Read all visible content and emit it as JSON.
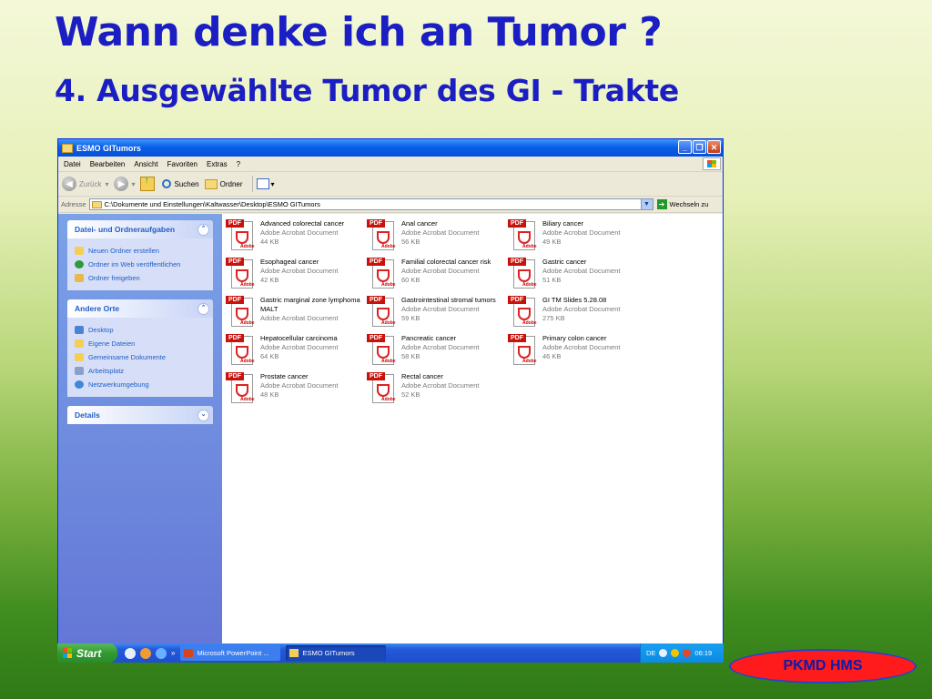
{
  "slide": {
    "title": "Wann denke ich an Tumor ?",
    "subtitle": "4. Ausgewählte Tumor des GI - Trakte",
    "badge": "PKMD HMS"
  },
  "window": {
    "title": "ESMO GITumors",
    "menu": [
      "Datei",
      "Bearbeiten",
      "Ansicht",
      "Favoriten",
      "Extras",
      "?"
    ],
    "toolbar": {
      "back": "Zurück",
      "search": "Suchen",
      "folders": "Ordner"
    },
    "address": {
      "label": "Adresse",
      "path": "C:\\Dokumente und Einstellungen\\Kaltwasser\\Desktop\\ESMO GITumors",
      "go": "Wechseln zu"
    },
    "panels": [
      {
        "title": "Datei- und Ordneraufgaben",
        "items": [
          "Neuen Ordner erstellen",
          "Ordner im Web veröffentlichen",
          "Ordner freigeben"
        ]
      },
      {
        "title": "Andere Orte",
        "items": [
          "Desktop",
          "Eigene Dateien",
          "Gemeinsame Dokumente",
          "Arbeitsplatz",
          "Netzwerkumgebung"
        ]
      },
      {
        "title": "Details",
        "items": []
      }
    ],
    "files": [
      {
        "name": "Advanced colorectal cancer",
        "type": "Adobe Acrobat Document",
        "size": "44 KB"
      },
      {
        "name": "Anal cancer",
        "type": "Adobe Acrobat Document",
        "size": "56 KB"
      },
      {
        "name": "Biliary cancer",
        "type": "Adobe Acrobat Document",
        "size": "49 KB"
      },
      {
        "name": "Esophageal cancer",
        "type": "Adobe Acrobat Document",
        "size": "42 KB"
      },
      {
        "name": "Familial colorectal cancer risk",
        "type": "Adobe Acrobat Document",
        "size": "60 KB"
      },
      {
        "name": "Gastric cancer",
        "type": "Adobe Acrobat Document",
        "size": "51 KB"
      },
      {
        "name": "Gastric marginal zone lymphoma MALT",
        "type": "Adobe Acrobat Document",
        "size": ""
      },
      {
        "name": "Gastrointestinal stromal tumors",
        "type": "Adobe Acrobat Document",
        "size": "59 KB"
      },
      {
        "name": "GI TM Slides 5.28.08",
        "type": "Adobe Acrobat Document",
        "size": "275 KB"
      },
      {
        "name": "Hepatocellular carcinoma",
        "type": "Adobe Acrobat Document",
        "size": "64 KB"
      },
      {
        "name": "Pancreatic cancer",
        "type": "Adobe Acrobat Document",
        "size": "58 KB"
      },
      {
        "name": "Primary colon cancer",
        "type": "Adobe Acrobat Document",
        "size": "46 KB"
      },
      {
        "name": "Prostate cancer",
        "type": "Adobe Acrobat Document",
        "size": "48 KB"
      },
      {
        "name": "Rectal cancer",
        "type": "Adobe Acrobat Document",
        "size": "52 KB"
      }
    ],
    "pdf_tag": "PDF",
    "pdf_brand": "Adobe"
  },
  "taskbar": {
    "start": "Start",
    "items": [
      "Microsoft PowerPoint ...",
      "ESMO GITumors"
    ],
    "language": "DE",
    "time": "06:19"
  }
}
